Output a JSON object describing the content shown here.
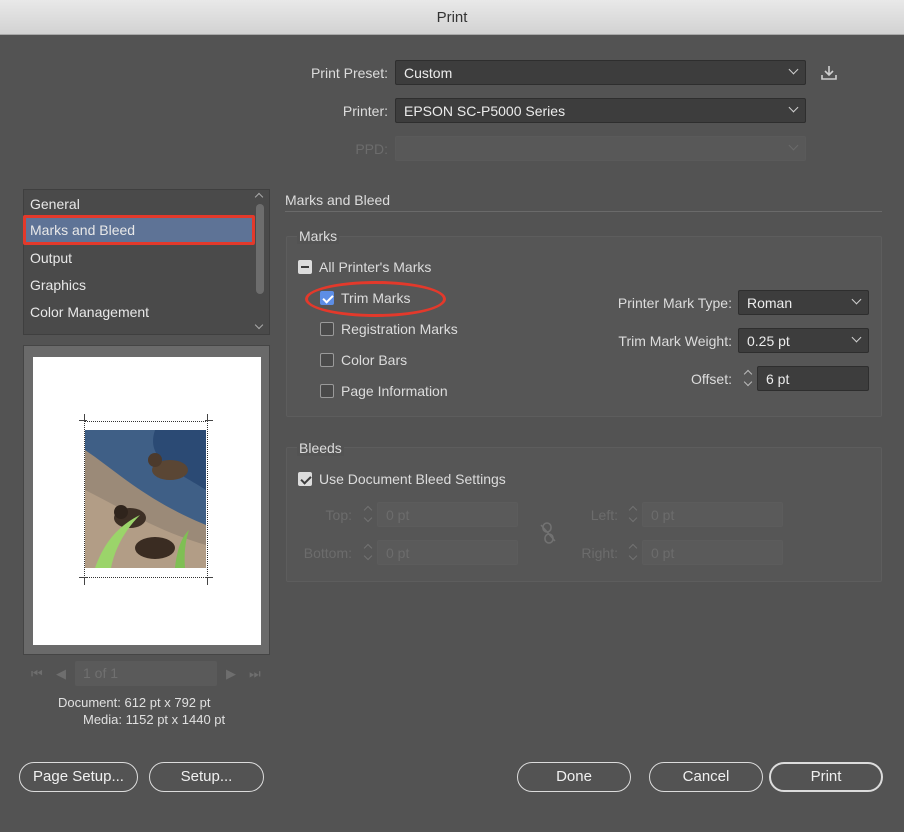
{
  "window": {
    "title": "Print"
  },
  "top": {
    "preset_label": "Print Preset:",
    "preset_value": "Custom",
    "printer_label": "Printer:",
    "printer_value": "EPSON SC-P5000 Series",
    "ppd_label": "PPD:",
    "ppd_value": ""
  },
  "sidebar": {
    "items": [
      {
        "label": "General"
      },
      {
        "label": "Marks and Bleed",
        "selected": true
      },
      {
        "label": "Output"
      },
      {
        "label": "Graphics"
      },
      {
        "label": "Color Management"
      }
    ]
  },
  "preview": {
    "page_indicator": "1 of 1",
    "document_info": "Document: 612 pt x 792 pt",
    "media_info": "Media: 1152 pt x 1440 pt"
  },
  "section": {
    "title": "Marks and Bleed"
  },
  "marks": {
    "group_label": "Marks",
    "all_label": "All Printer's Marks",
    "trim_label": "Trim Marks",
    "trim_checked": true,
    "registration_label": "Registration Marks",
    "colorbars_label": "Color Bars",
    "pageinfo_label": "Page Information",
    "type_label": "Printer Mark Type:",
    "type_value": "Roman",
    "weight_label": "Trim Mark Weight:",
    "weight_value": "0.25 pt",
    "offset_label": "Offset:",
    "offset_value": "6 pt"
  },
  "bleeds": {
    "group_label": "Bleeds",
    "use_doc_label": "Use Document Bleed Settings",
    "use_doc_checked": true,
    "top_label": "Top:",
    "top_value": "0 pt",
    "bottom_label": "Bottom:",
    "bottom_value": "0 pt",
    "left_label": "Left:",
    "left_value": "0 pt",
    "right_label": "Right:",
    "right_value": "0 pt"
  },
  "buttons": {
    "page_setup": "Page Setup...",
    "setup": "Setup...",
    "done": "Done",
    "cancel": "Cancel",
    "print": "Print"
  },
  "colors": {
    "accent": "#5d8ee6",
    "highlight": "#e3392b",
    "selection": "#5e7396"
  },
  "icons": [
    "save-preset-icon",
    "chevron-down-icon",
    "link-icon",
    "first-page-icon",
    "prev-page-icon",
    "next-page-icon",
    "last-page-icon"
  ]
}
